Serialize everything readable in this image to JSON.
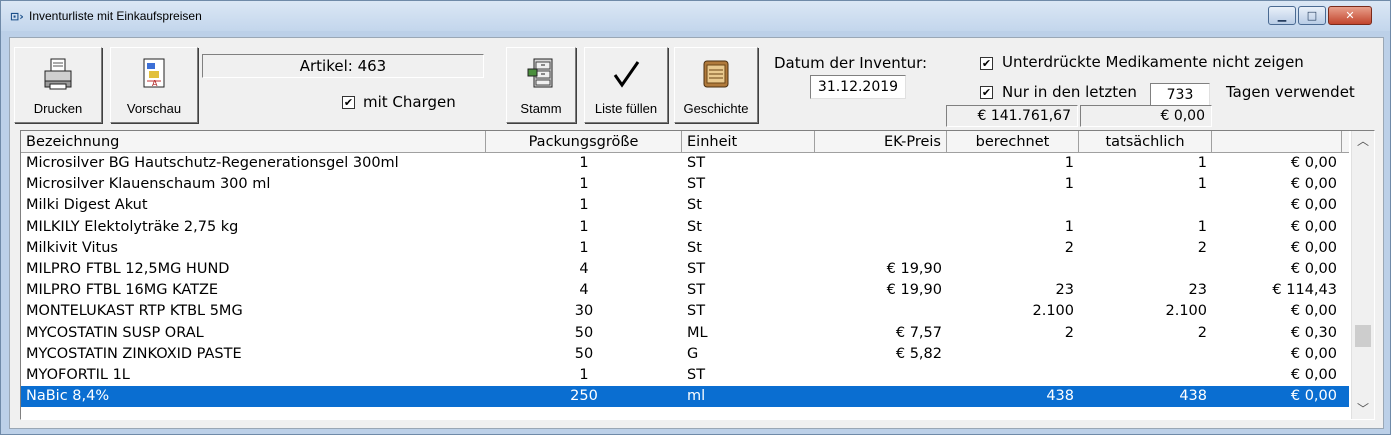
{
  "window": {
    "title": "Inventurliste mit Einkaufspreisen",
    "icon": "app-icon",
    "controls": [
      "minimize-icon",
      "maximize-icon",
      "close-icon"
    ]
  },
  "toolbar": {
    "print_label": "Drucken",
    "preview_label": "Vorschau",
    "master_label": "Stamm",
    "fill_label": "Liste füllen",
    "history_label": "Geschichte"
  },
  "article_count": "Artikel: 463",
  "with_batches": {
    "label": "mit Chargen",
    "checked": true
  },
  "inventory_date": {
    "label": "Datum der Inventur:",
    "value": "31.12.2019"
  },
  "hide_suppressed": {
    "label": "Unterdrückte Medikamente nicht zeigen",
    "checked": true
  },
  "last_days": {
    "label_before": "Nur in den letzten",
    "value": "733",
    "label_after": "Tagen verwendet",
    "checked": true
  },
  "totals": {
    "calculated": "€ 141.761,67",
    "actual": "€ 0,00"
  },
  "grid": {
    "columns": [
      "Bezeichnung",
      "Packungsgröße",
      "Einheit",
      "EK-Preis",
      "berechnet",
      "tatsächlich",
      ""
    ],
    "rows": [
      [
        "Microsilver BG Hautschutz-Regenerationsgel 300ml",
        "1",
        "ST",
        "",
        "1",
        "1",
        "€ 0,00"
      ],
      [
        "Microsilver Klauenschaum 300 ml",
        "1",
        "ST",
        "",
        "1",
        "1",
        "€ 0,00"
      ],
      [
        "Milki Digest  Akut",
        "1",
        "St",
        "",
        "",
        "",
        "€ 0,00"
      ],
      [
        "MILKILY Elektolyträke 2,75 kg",
        "1",
        "St",
        "",
        "1",
        "1",
        "€ 0,00"
      ],
      [
        "Milkivit Vitus",
        "1",
        "St",
        "",
        "2",
        "2",
        "€ 0,00"
      ],
      [
        "MILPRO FTBL 12,5MG HUND",
        "4",
        "ST",
        "€ 19,90",
        "",
        "",
        "€ 0,00"
      ],
      [
        "MILPRO FTBL 16MG KATZE",
        "4",
        "ST",
        "€ 19,90",
        "23",
        "23",
        "€ 114,43"
      ],
      [
        "MONTELUKAST RTP KTBL  5MG",
        "30",
        "ST",
        "",
        "2.100",
        "2.100",
        "€ 0,00"
      ],
      [
        "MYCOSTATIN SUSP ORAL",
        "50",
        "ML",
        "€ 7,57",
        "2",
        "2",
        "€ 0,30"
      ],
      [
        "MYCOSTATIN ZINKOXID PASTE",
        "50",
        "G",
        "€ 5,82",
        "",
        "",
        "€ 0,00"
      ],
      [
        "MYOFORTIL 1L",
        "1",
        "ST",
        "",
        "",
        "",
        "€ 0,00"
      ],
      [
        "NaBic 8,4%",
        "250",
        "ml",
        "",
        "438",
        "438",
        "€ 0,00"
      ]
    ],
    "selected_row": 11
  }
}
